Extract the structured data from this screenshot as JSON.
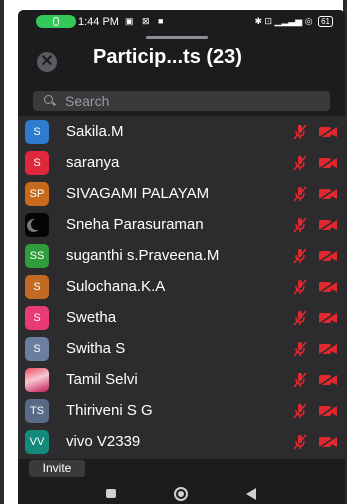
{
  "status_bar": {
    "time": "1:44 PM",
    "icons_left": "▣ ⊠ ■",
    "icons_right": "✱ ⊡ ▁▂▃▅ ◎",
    "battery": "61"
  },
  "header": {
    "title": "Particip...ts (23)",
    "close_symbol": "✕"
  },
  "search": {
    "placeholder": "Search"
  },
  "participants": [
    {
      "initials": "S",
      "name": "Sakila.M",
      "avatar_color": "#2e7bd0",
      "avatar_kind": "initials"
    },
    {
      "initials": "S",
      "name": "saranya",
      "avatar_color": "#e0283c",
      "avatar_kind": "initials"
    },
    {
      "initials": "SP",
      "name": "SIVAGAMI PALAYAM",
      "avatar_color": "#c86a1c",
      "avatar_kind": "initials"
    },
    {
      "initials": "",
      "name": "Sneha Parasuraman",
      "avatar_color": "#050505",
      "avatar_kind": "moon"
    },
    {
      "initials": "SS",
      "name": "suganthi s.Praveena.M",
      "avatar_color": "#2e9e3c",
      "avatar_kind": "initials"
    },
    {
      "initials": "S",
      "name": "Sulochana.K.A",
      "avatar_color": "#c26a22",
      "avatar_kind": "initials"
    },
    {
      "initials": "S",
      "name": "Swetha",
      "avatar_color": "#ea3a74",
      "avatar_kind": "initials"
    },
    {
      "initials": "S",
      "name": "Switha S",
      "avatar_color": "#6a7f9e",
      "avatar_kind": "initials"
    },
    {
      "initials": "",
      "name": "Tamil Selvi",
      "avatar_color": "#e84a5f",
      "avatar_kind": "photo"
    },
    {
      "initials": "TS",
      "name": "Thiriveni S G",
      "avatar_color": "#596a86",
      "avatar_kind": "initials"
    },
    {
      "initials": "VV",
      "name": "vivo V2339",
      "avatar_color": "#138a7a",
      "avatar_kind": "initials"
    }
  ],
  "invite_label": "Invite",
  "colors": {
    "mute_red": "#e0282e",
    "background": "#2c2c2e",
    "status_pill": "#34c759"
  }
}
